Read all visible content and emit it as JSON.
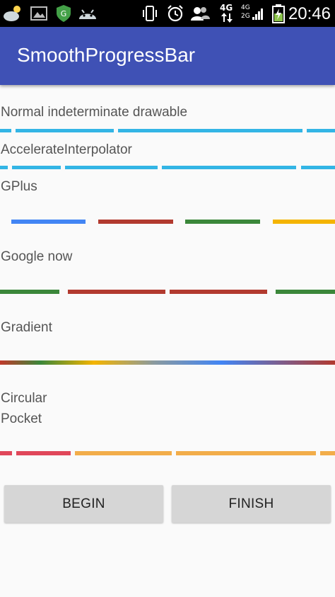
{
  "status_bar": {
    "time": "20:46",
    "network_4g": "4G",
    "network_4g_small": "4G",
    "network_2g_small": "2G"
  },
  "app_bar": {
    "title": "SmoothProgressBar"
  },
  "progress_bars": [
    {
      "id": "normal",
      "label": "Normal indeterminate drawable",
      "colors": [
        "#33b5e5"
      ]
    },
    {
      "id": "accelerate",
      "label": "AccelerateInterpolator",
      "colors": [
        "#33b5e5"
      ]
    },
    {
      "id": "gplus",
      "label": "GPlus",
      "colors": [
        "#4285f4",
        "#b23a2f",
        "#3b873a",
        "#f4b400"
      ]
    },
    {
      "id": "google-now",
      "label": "Google now",
      "colors": [
        "#3b873a",
        "#b23a2f"
      ]
    },
    {
      "id": "gradient",
      "label": "Gradient",
      "colors": [
        "#c0392b",
        "#3b873a",
        "#f4b400",
        "#4285f4",
        "#b23a2f"
      ]
    },
    {
      "id": "circular",
      "label": "Circular"
    },
    {
      "id": "pocket",
      "label": "Pocket",
      "colors": [
        "#e0475a",
        "#f2ad4a"
      ]
    }
  ],
  "buttons": {
    "begin": "BEGIN",
    "finish": "FINISH"
  }
}
